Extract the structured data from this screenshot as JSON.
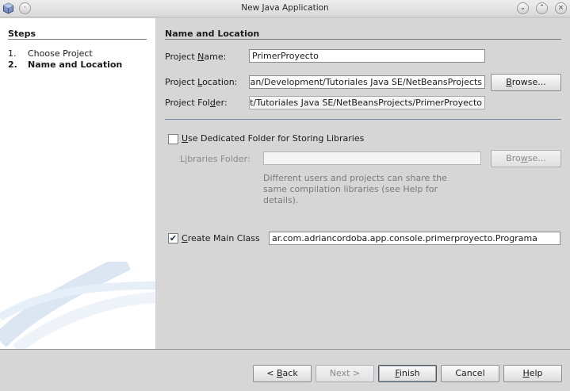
{
  "window": {
    "title": "New Java Application"
  },
  "steps": {
    "heading": "Steps",
    "items": [
      {
        "num": "1.",
        "label": "Choose Project"
      },
      {
        "num": "2.",
        "label": "Name and Location"
      }
    ]
  },
  "main": {
    "section_title": "Name and Location",
    "project_name": {
      "label_pre": "Project ",
      "label_u": "N",
      "label_post": "ame:",
      "value": "PrimerProyecto"
    },
    "project_location": {
      "label_pre": "Project ",
      "label_u": "L",
      "label_post": "ocation:",
      "value": "‎/home/adrian/Development/Tutoriales Java SE/NetBeansProjects"
    },
    "browse_1": {
      "u": "B",
      "rest": "rowse..."
    },
    "project_folder": {
      "label_pre": "Project Fol",
      "label_u": "d",
      "label_post": "er:",
      "value": "‎/home/adrian/Development/Tutoriales Java SE/NetBeansProjects/PrimerProyecto"
    },
    "dedicated": {
      "u": "U",
      "rest": "se Dedicated Folder for Storing Libraries",
      "checked": false
    },
    "libraries": {
      "label_pre": "L",
      "label_u": "i",
      "label_post": "braries Folder:",
      "value": ""
    },
    "browse_2": {
      "pre": "Bro",
      "u": "w",
      "rest": "se..."
    },
    "help_text": "Different users and projects can share the same compilation libraries (see Help for details).",
    "main_class": {
      "checkbox_mark": "✔",
      "u": "C",
      "rest": "reate Main Class",
      "checked": true,
      "value": "ar.com.adriancordoba.app.console.primerproyecto.Programa"
    }
  },
  "footer": {
    "back": {
      "pre": "< ",
      "u": "B",
      "rest": "ack"
    },
    "next": {
      "label": "Next >"
    },
    "finish": {
      "u": "F",
      "rest": "inish"
    },
    "cancel": {
      "label": "Cancel"
    },
    "help": {
      "u": "H",
      "rest": "elp"
    }
  },
  "colors": {
    "panel": "#d6d6d6",
    "steps_bg": "#ffffff",
    "accent_rule": "#7389ad"
  },
  "icons": [
    "app-cube-icon",
    "window-menu-icon",
    "minimize-icon",
    "maximize-icon",
    "close-icon",
    "checkmark-icon"
  ]
}
